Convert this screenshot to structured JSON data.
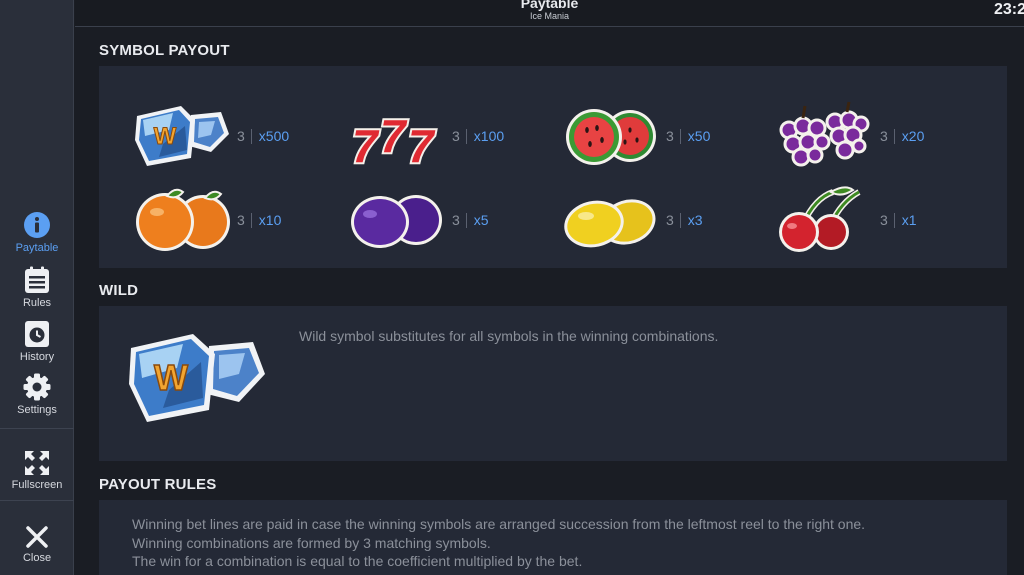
{
  "header": {
    "title": "Paytable",
    "subtitle": "Ice Mania",
    "clock": "23:2"
  },
  "sidebar": {
    "items": [
      {
        "label": "Paytable",
        "icon": "info-icon",
        "active": true
      },
      {
        "label": "Rules",
        "icon": "rules-icon"
      },
      {
        "label": "History",
        "icon": "history-icon"
      },
      {
        "label": "Settings",
        "icon": "gear-icon"
      },
      {
        "label": "Fullscreen",
        "icon": "fullscreen-icon"
      },
      {
        "label": "Close",
        "icon": "close-icon"
      }
    ]
  },
  "symbol_payout": {
    "title": "SYMBOL PAYOUT",
    "symbols": [
      {
        "name": "wild-ice-cube",
        "count": "3",
        "multiplier": "x500"
      },
      {
        "name": "sevens",
        "count": "3",
        "multiplier": "x100"
      },
      {
        "name": "watermelon",
        "count": "3",
        "multiplier": "x50"
      },
      {
        "name": "grapes",
        "count": "3",
        "multiplier": "x20"
      },
      {
        "name": "orange",
        "count": "3",
        "multiplier": "x10"
      },
      {
        "name": "plum",
        "count": "3",
        "multiplier": "x5"
      },
      {
        "name": "lemon",
        "count": "3",
        "multiplier": "x3"
      },
      {
        "name": "cherry",
        "count": "3",
        "multiplier": "x1"
      }
    ]
  },
  "wild": {
    "title": "WILD",
    "description": "Wild symbol substitutes for all symbols in the winning combinations."
  },
  "payout_rules": {
    "title": "PAYOUT RULES",
    "lines": [
      "Winning bet lines are paid in case the winning symbols are arranged succession from the leftmost reel to the right one.",
      "Winning combinations are formed by 3 matching symbols.",
      "The win for a combination is equal to the coefficient multiplied by the bet."
    ]
  },
  "colors": {
    "accent": "#5b9ff2",
    "panel": "#242936",
    "background": "#1a1d24",
    "sidebar": "#2a2f3a"
  }
}
